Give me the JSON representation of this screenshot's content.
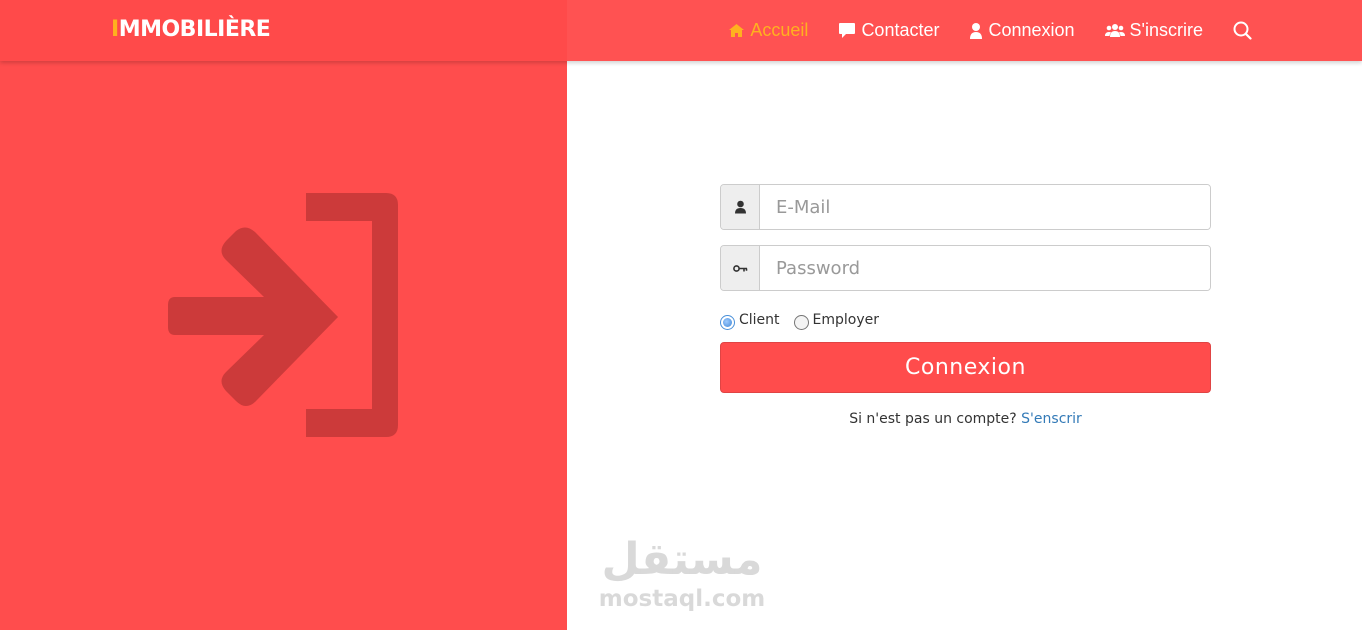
{
  "brand": {
    "logo_accent": "I",
    "logo_rest": "MMOBILIÈRE"
  },
  "colors": {
    "primary": "#ff4d4d",
    "accent": "#ffb11f",
    "link": "#337ab7"
  },
  "nav": {
    "items": [
      {
        "label": "Accueil",
        "icon": "home-icon",
        "active": true
      },
      {
        "label": "Contacter",
        "icon": "comment-icon",
        "active": false
      },
      {
        "label": "Connexion",
        "icon": "user-icon",
        "active": false
      },
      {
        "label": "S'inscrire",
        "icon": "users-icon",
        "active": false
      }
    ],
    "search_icon": "search-icon"
  },
  "hero": {
    "icon": "sign-in-icon"
  },
  "login": {
    "email_placeholder": "E-Mail",
    "email_icon": "user-icon",
    "password_placeholder": "Password",
    "password_icon": "key-icon",
    "roles": [
      {
        "label": "Client",
        "checked": true
      },
      {
        "label": "Employer",
        "checked": false
      }
    ],
    "submit_label": "Connexion",
    "signup_prompt": "Si n'est pas un compte?",
    "signup_link": "S'enscrir"
  },
  "watermark": {
    "arabic": "مستقل",
    "latin": "mostaql.com"
  }
}
